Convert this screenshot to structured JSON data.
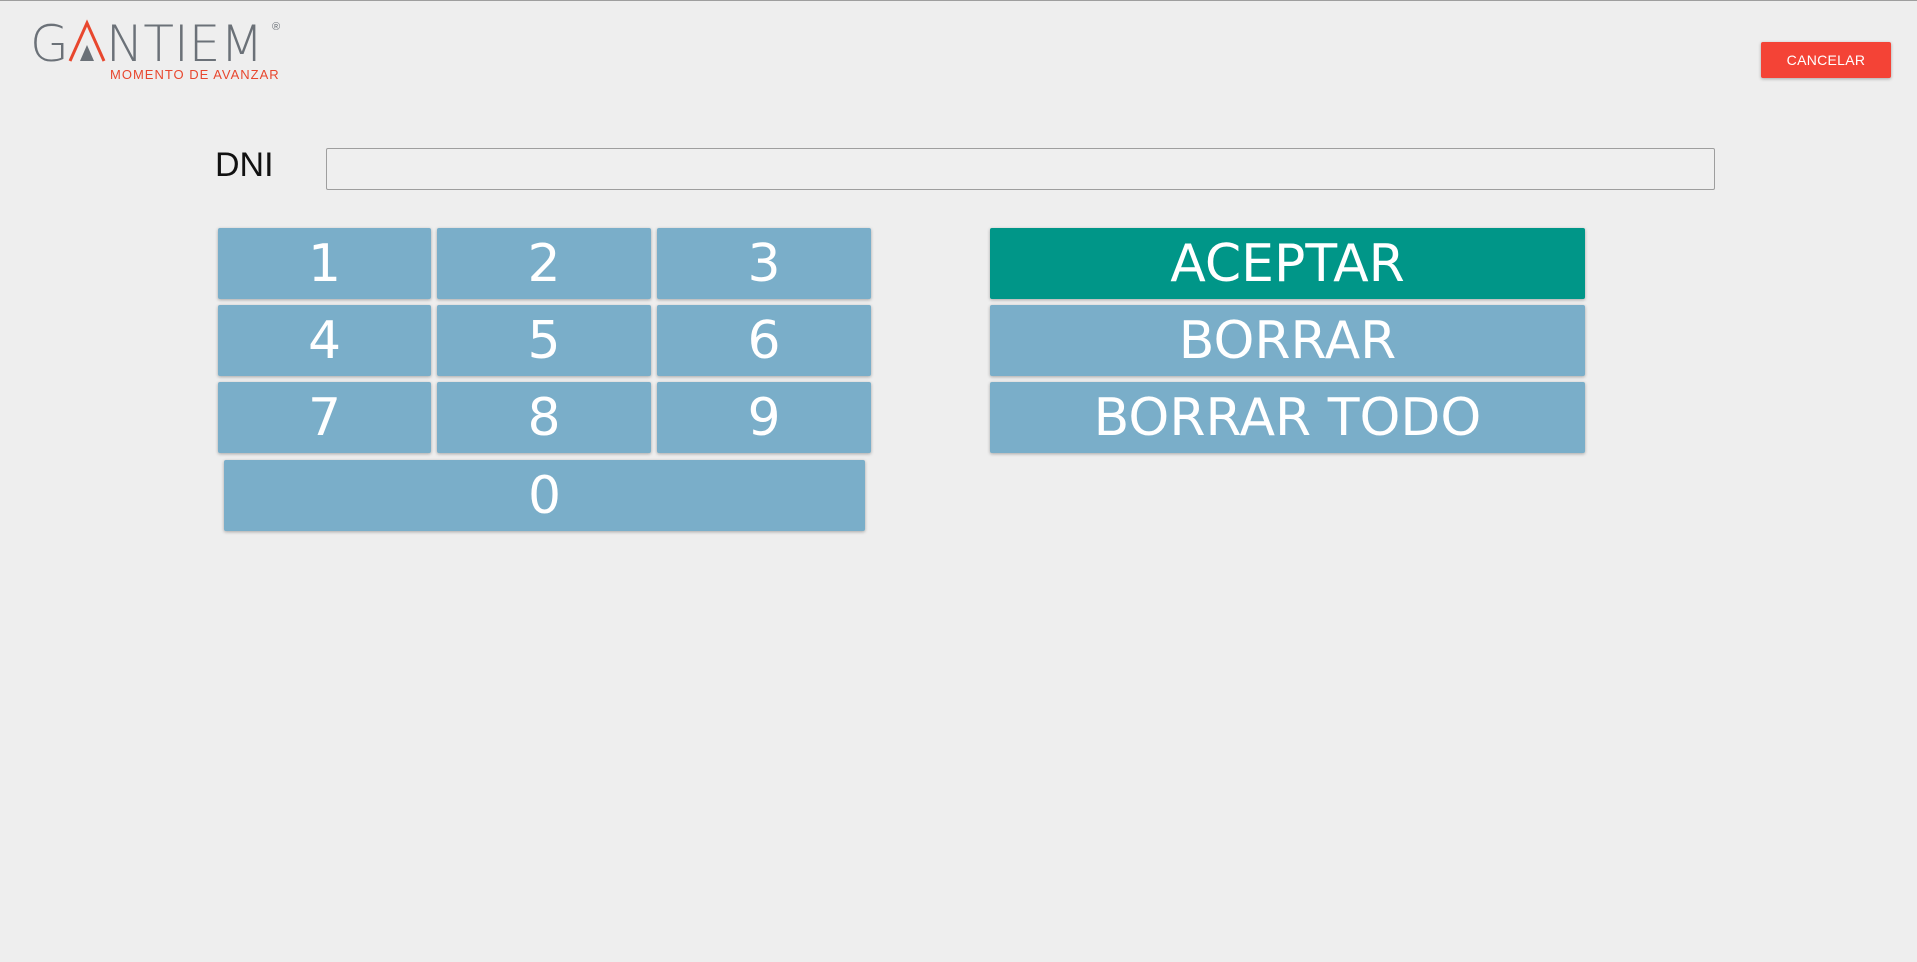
{
  "header": {
    "logo_word": "GANTIEM",
    "logo_registered": "®",
    "logo_tagline": "MOMENTO DE AVANZAR",
    "brand_gray": "#6b7178",
    "brand_accent": "#e8472e",
    "cancel_label": "CANCELAR",
    "cancel_color": "#f44336"
  },
  "form": {
    "dni_label": "DNI",
    "dni_value": "",
    "dni_placeholder": ""
  },
  "keypad": {
    "key_color": "#7aaec9",
    "keys": [
      "1",
      "2",
      "3",
      "4",
      "5",
      "6",
      "7",
      "8",
      "9",
      "0"
    ]
  },
  "actions": {
    "accept_label": "ACEPTAR",
    "accept_color": "#009688",
    "delete_label": "BORRAR",
    "delete_all_label": "BORRAR TODO"
  }
}
